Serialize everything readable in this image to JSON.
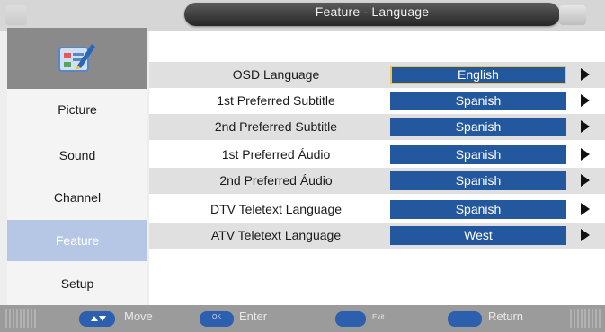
{
  "header": {
    "title": "Feature - Language"
  },
  "sidebar": {
    "items": [
      {
        "label": "Picture",
        "active": false
      },
      {
        "label": "Sound",
        "active": false
      },
      {
        "label": "Channel",
        "active": false
      },
      {
        "label": "Feature",
        "active": true
      },
      {
        "label": "Setup",
        "active": false
      }
    ]
  },
  "settings": [
    {
      "label": "OSD Language",
      "value": "English",
      "focused": true
    },
    {
      "label": "1st Preferred Subtitle",
      "value": "Spanish"
    },
    {
      "label": "2nd Preferred Subtitle",
      "value": "Spanish"
    },
    {
      "label": "1st Preferred Áudio",
      "value": "Spanish"
    },
    {
      "label": "2nd Preferred Áudio",
      "value": "Spanish"
    },
    {
      "label": "DTV Teletext Language",
      "value": "Spanish"
    },
    {
      "label": "ATV Teletext Language",
      "value": "West"
    }
  ],
  "footer": {
    "move_label": "Move",
    "enter_label": "Enter",
    "enter_key_text": "OK",
    "exit_label": "Exit",
    "exit_key_text": "",
    "return_label": "Return",
    "return_key_text": ""
  },
  "colors": {
    "value_bg": "#23579e",
    "focus_border": "#f2c54a",
    "sidebar_active": "#b6c7e6",
    "key_bg": "#2c5fae"
  },
  "icons": [
    "feature-settings-icon",
    "arrow-right-icon",
    "up-down-arrows-icon"
  ]
}
